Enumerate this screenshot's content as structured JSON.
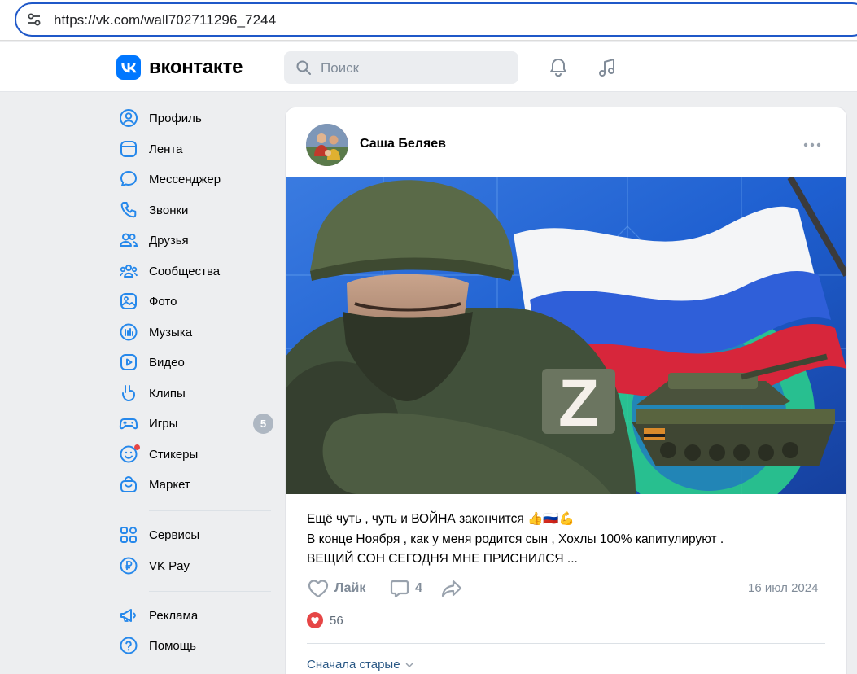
{
  "browser": {
    "url": "https://vk.com/wall702711296_7244"
  },
  "header": {
    "wordmark": "вконтакте",
    "search_placeholder": "Поиск",
    "icons": [
      "notifications-bell-icon",
      "music-note-icon"
    ],
    "brand_color": "#0077ff"
  },
  "sidebar": {
    "items": [
      {
        "label": "Профиль",
        "icon": "user-circle-icon"
      },
      {
        "label": "Лента",
        "icon": "newsfeed-icon"
      },
      {
        "label": "Мессенджер",
        "icon": "message-icon"
      },
      {
        "label": "Звонки",
        "icon": "phone-icon"
      },
      {
        "label": "Друзья",
        "icon": "friends-icon"
      },
      {
        "label": "Сообщества",
        "icon": "communities-icon"
      },
      {
        "label": "Фото",
        "icon": "photo-icon"
      },
      {
        "label": "Музыка",
        "icon": "music-icon"
      },
      {
        "label": "Видео",
        "icon": "video-icon"
      },
      {
        "label": "Клипы",
        "icon": "clips-icon"
      },
      {
        "label": "Игры",
        "icon": "gamepad-icon",
        "badge": "5"
      },
      {
        "label": "Стикеры",
        "icon": "smile-icon",
        "dot": true
      },
      {
        "label": "Маркет",
        "icon": "bag-icon"
      },
      {
        "label": "Сервисы",
        "icon": "services-grid-icon"
      },
      {
        "label": "VK Pay",
        "icon": "ruble-icon"
      },
      {
        "label": "Реклама",
        "icon": "megaphone-icon"
      },
      {
        "label": "Помощь",
        "icon": "help-icon"
      }
    ]
  },
  "post": {
    "author": "Саша Беляев",
    "text_lines": [
      "Ещё чуть , чуть и ВОЙНА закончится 👍🇷🇺💪",
      "В конце Ноября , как у меня родится сын , Хохлы 100% капитулируют .",
      "ВЕЩИЙ СОН СЕГОДНЯ МНЕ ПРИСНИЛСЯ ..."
    ],
    "like_label": "Лайк",
    "comments_count": "4",
    "date": "16 июл 2024",
    "reactions_count": "56",
    "sort_label": "Сначала старые",
    "image": {
      "description_icon": "soldier-flag-tank-illustration",
      "letter": "Z"
    }
  }
}
